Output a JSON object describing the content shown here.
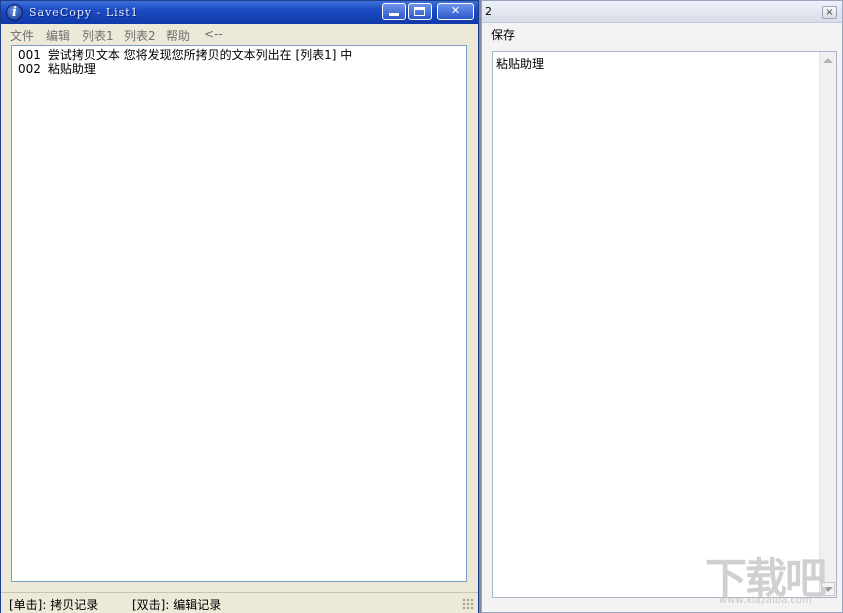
{
  "left_window": {
    "title": "SaveCopy - List1",
    "menu": [
      "文件",
      "编辑",
      "列表1",
      "列表2",
      "帮助",
      "<--"
    ],
    "list_rows": [
      {
        "num": "001",
        "text": "尝试拷贝文本 您将发现您所拷贝的文本列出在 [列表1] 中"
      },
      {
        "num": "002",
        "text": "粘贴助理"
      }
    ],
    "status": {
      "single_click": "[单击]: 拷贝记录",
      "double_click": "[双击]: 编辑记录"
    }
  },
  "right_window": {
    "title": "2",
    "menu_save": "保存",
    "editor_text": "粘贴助理",
    "close_glyph": "×"
  },
  "watermark": {
    "big": "下载吧",
    "small": "www.xiazaiba.com"
  },
  "icons": {
    "app": "info-icon",
    "minimize": "minimize-icon",
    "maximize": "maximize-icon",
    "close": "close-icon"
  },
  "colors": {
    "titlebar": "#1b4bc4",
    "window_bg": "#ece9d8",
    "menu_disabled": "#6f6f6f"
  }
}
